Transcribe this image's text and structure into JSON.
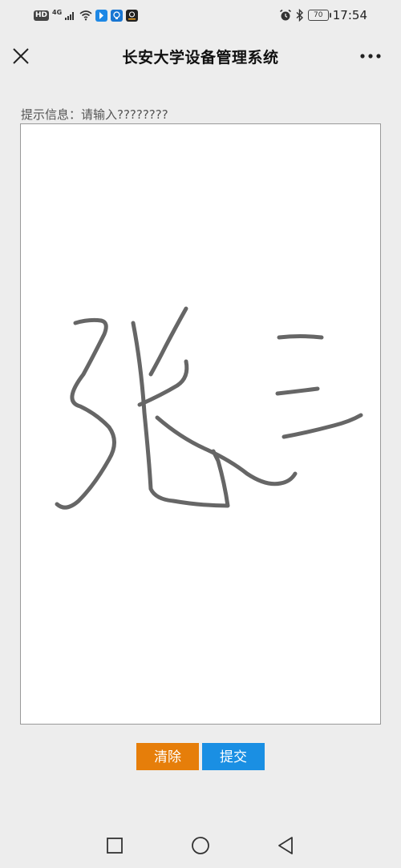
{
  "status_bar": {
    "hd": "HD",
    "network": "4G",
    "battery": "70",
    "time": "17:54",
    "icons": [
      "signal-icon",
      "wifi-icon",
      "app-icon-blue",
      "app-icon-bulb",
      "app-icon-dark",
      "alarm-icon",
      "bluetooth-icon"
    ]
  },
  "header": {
    "title": "长安大学设备管理系统",
    "close_icon": "close-icon",
    "more_icon": "more-icon"
  },
  "prompt": {
    "text": "提示信息：请输入????????"
  },
  "signature": {
    "content": "handwritten-signature"
  },
  "buttons": {
    "clear_label": "清除",
    "submit_label": "提交"
  },
  "nav": {
    "icons": [
      "recent-apps-icon",
      "home-icon",
      "back-icon"
    ]
  },
  "colors": {
    "background": "#ededed",
    "pad": "#ffffff",
    "stroke": "#666666",
    "clear_button": "#e67e0a",
    "submit_button": "#1a8fe3"
  }
}
